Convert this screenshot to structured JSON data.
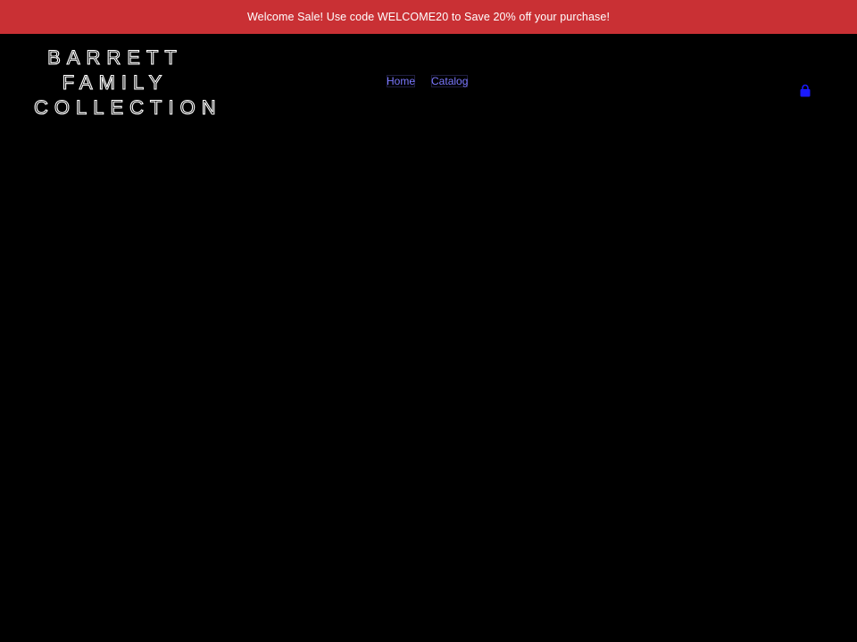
{
  "announcement": {
    "text": "Welcome Sale! Use code WELCOME20 to Save 20% off your purchase!"
  },
  "header": {
    "logo_lines": [
      "BARRETT",
      "FAMILY",
      "COLLECTION"
    ],
    "nav": [
      {
        "label": "Home"
      },
      {
        "label": "Catalog"
      }
    ],
    "cart_icon": "cart-bag-icon"
  },
  "colors": {
    "announcement_bg": "#c93034",
    "page_bg": "#000000",
    "nav_link": "#7b78ff",
    "cart_icon": "#1a1aff"
  }
}
